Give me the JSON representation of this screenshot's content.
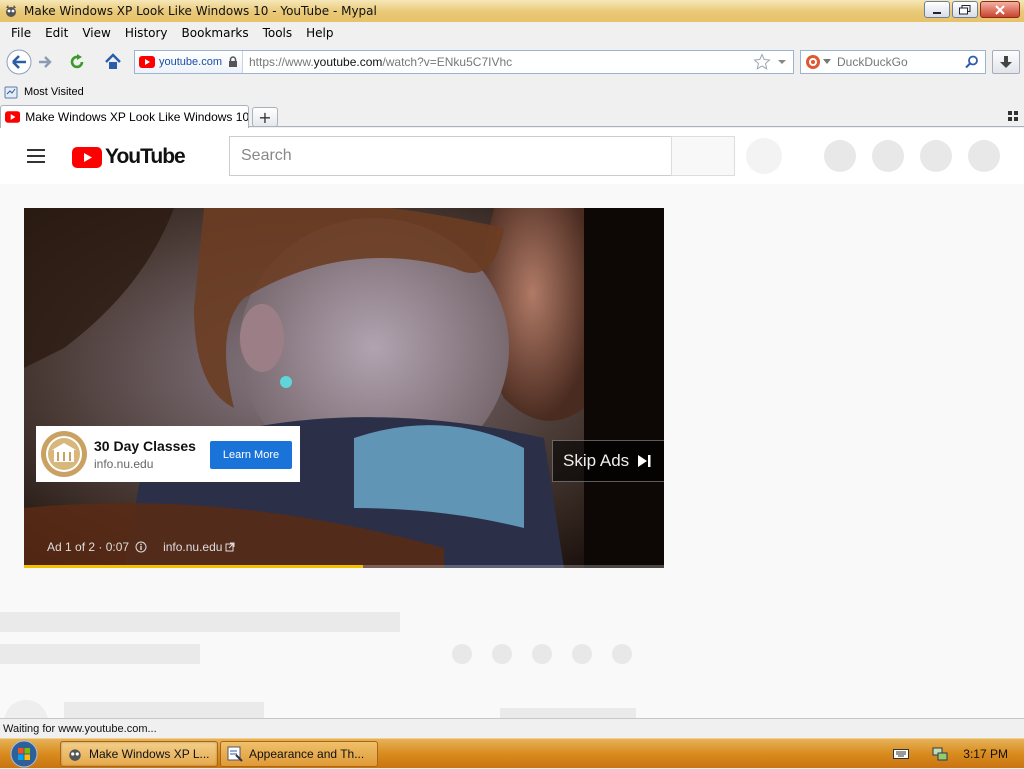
{
  "window": {
    "title": "Make Windows XP Look Like Windows 10 - YouTube - Mypal"
  },
  "menu": [
    "File",
    "Edit",
    "View",
    "History",
    "Bookmarks",
    "Tools",
    "Help"
  ],
  "addressbar": {
    "site_identity": "youtube.com",
    "url_prefix": "https://www.",
    "url_host": "youtube.com",
    "url_rest": "/watch?v=ENku5C7IVhc"
  },
  "searchbar": {
    "placeholder": "DuckDuckGo"
  },
  "bookmarks": {
    "most_visited": "Most Visited"
  },
  "tabs": [
    {
      "label": "Make Windows XP Look Like Windows 10..."
    }
  ],
  "youtube": {
    "logo_text": "YouTube",
    "search_placeholder": "Search"
  },
  "ad": {
    "card_title": "30 Day Classes",
    "card_domain": "info.nu.edu",
    "learn_more": "Learn More",
    "skip": "Skip Ads",
    "info_text": "Ad 1 of 2 · 0:07",
    "info_domain": "info.nu.edu",
    "progress_fraction": 0.53
  },
  "status": {
    "text": "Waiting for www.youtube.com..."
  },
  "taskbar": {
    "items": [
      {
        "label": "Make Windows XP L..."
      },
      {
        "label": "Appearance and Th..."
      }
    ],
    "clock": "3:17 PM"
  },
  "colors": {
    "accent": "#1a73d9",
    "youtube_red": "#ff0000",
    "ad_progress": "#f2c200"
  }
}
